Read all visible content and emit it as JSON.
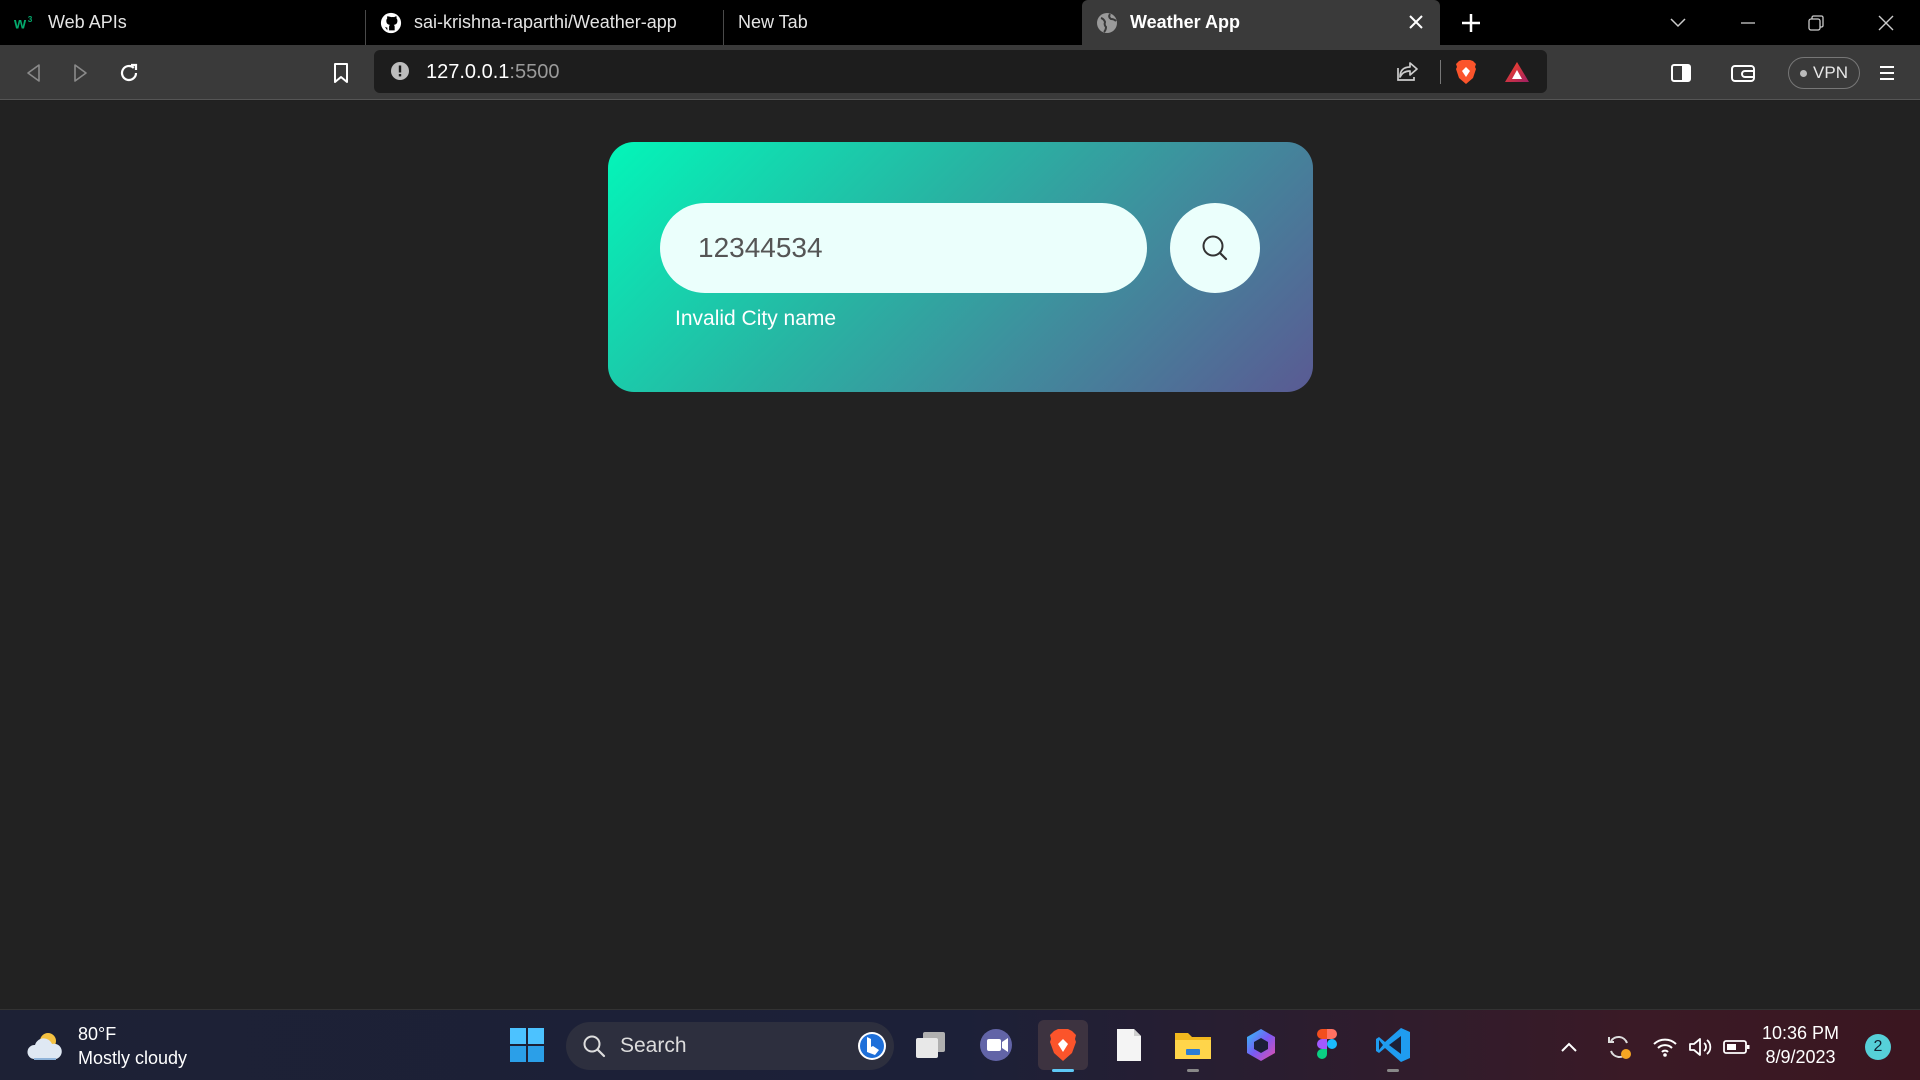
{
  "browser": {
    "tabs": [
      {
        "title": "Web APIs",
        "icon": "w3schools-icon"
      },
      {
        "title": "sai-krishna-raparthi/Weather-app",
        "icon": "github-icon"
      },
      {
        "title": "New Tab",
        "icon": ""
      },
      {
        "title": "Weather App",
        "icon": "globe-icon",
        "active": true
      }
    ],
    "address": {
      "host": "127.0.0.1",
      "port": ":5500"
    },
    "vpn_label": "VPN"
  },
  "app": {
    "search": {
      "value": "12344534",
      "placeholder": ""
    },
    "error_message": "Invalid City name",
    "colors": {
      "gradient_start": "#03f6b9",
      "gradient_end": "#5a5a93",
      "input_bg": "#ebfffc"
    }
  },
  "taskbar": {
    "weather": {
      "temp": "80°F",
      "condition": "Mostly cloudy"
    },
    "search_label": "Search",
    "apps": [
      "task-view",
      "teams-meet",
      "brave",
      "notepad",
      "file-explorer",
      "copilot",
      "figma",
      "vscode"
    ],
    "clock": {
      "time": "10:36 PM",
      "date": "8/9/2023"
    },
    "notification_count": "2"
  }
}
